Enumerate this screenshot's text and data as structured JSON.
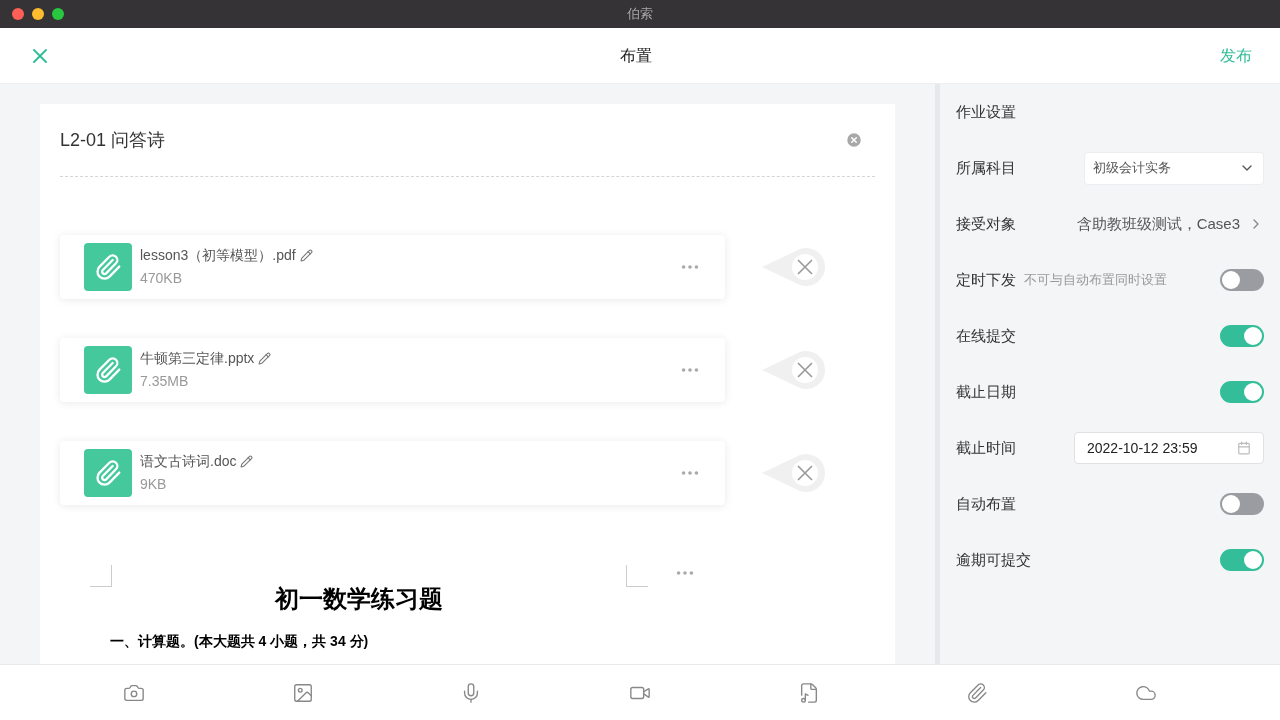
{
  "window": {
    "title": "伯索"
  },
  "header": {
    "title": "布置",
    "publish": "发布"
  },
  "assignment": {
    "title": "L2-01 问答诗",
    "attachments": [
      {
        "name": "lesson3（初等模型）.pdf",
        "size": "470KB"
      },
      {
        "name": "牛顿第三定律.pptx",
        "size": "7.35MB"
      },
      {
        "name": "语文古诗词.doc",
        "size": "9KB"
      }
    ],
    "document": {
      "heading": "初一数学练习题",
      "section": "一、计算题。(本大题共 4 小题，共 34 分)"
    }
  },
  "settings": {
    "title": "作业设置",
    "rows": [
      {
        "kind": "select",
        "label": "所属科目",
        "value": "初级会计实务"
      },
      {
        "kind": "link",
        "label": "接受对象",
        "value": "含助教班级测试，Case3"
      },
      {
        "kind": "toggle",
        "label": "定时下发",
        "hint": "不可与自动布置同时设置",
        "on": false
      },
      {
        "kind": "toggle",
        "label": "在线提交",
        "on": true
      },
      {
        "kind": "toggle",
        "label": "截止日期",
        "on": true
      },
      {
        "kind": "date",
        "label": "截止时间",
        "value": "2022-10-12 23:59"
      },
      {
        "kind": "toggle",
        "label": "自动布置",
        "on": false
      },
      {
        "kind": "toggle",
        "label": "逾期可提交",
        "on": true
      }
    ]
  }
}
